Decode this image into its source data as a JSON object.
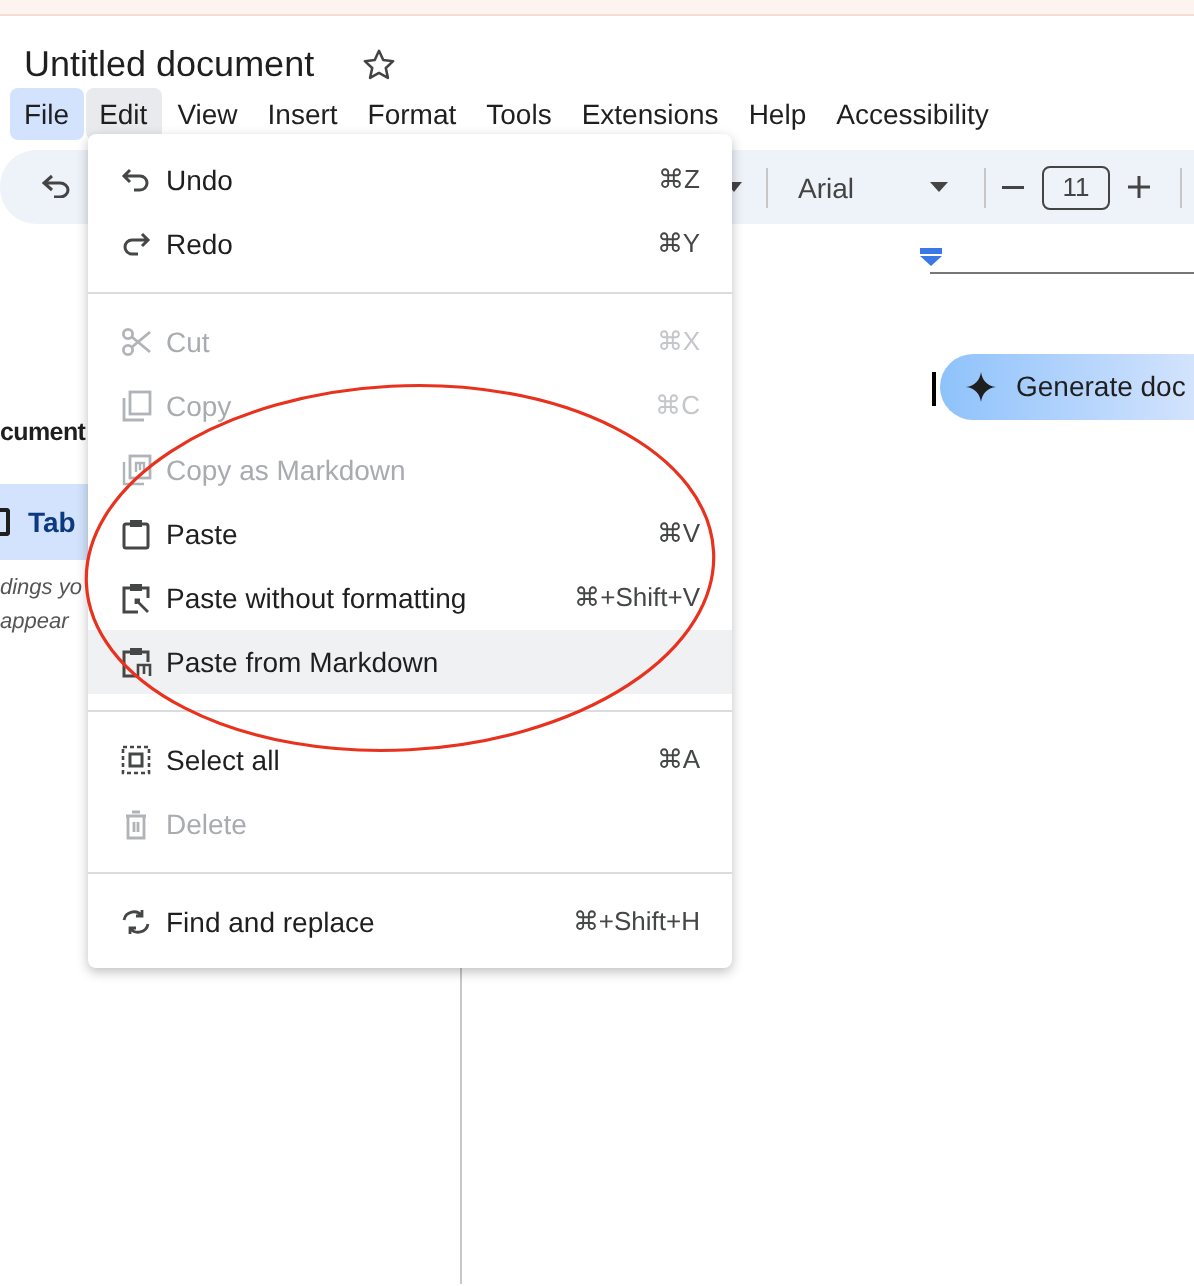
{
  "document": {
    "title": "Untitled document",
    "starred": false
  },
  "menubar": [
    {
      "label": "File",
      "selected": false,
      "highlighted": true
    },
    {
      "label": "Edit",
      "selected": true,
      "highlighted": false
    },
    {
      "label": "View",
      "selected": false,
      "highlighted": false
    },
    {
      "label": "Insert",
      "selected": false,
      "highlighted": false
    },
    {
      "label": "Format",
      "selected": false,
      "highlighted": false
    },
    {
      "label": "Tools",
      "selected": false,
      "highlighted": false
    },
    {
      "label": "Extensions",
      "selected": false,
      "highlighted": false
    },
    {
      "label": "Help",
      "selected": false,
      "highlighted": false
    },
    {
      "label": "Accessibility",
      "selected": false,
      "highlighted": false
    }
  ],
  "toolbar": {
    "font": "Arial",
    "font_size": "11"
  },
  "side_panel": {
    "heading": "cument",
    "tab": {
      "label": "Tab",
      "selected": true
    },
    "hint_lines": [
      "dings yo",
      "appear"
    ]
  },
  "generate_button": {
    "label": "Generate doc"
  },
  "edit_menu": [
    {
      "kind": "item",
      "label": "Undo",
      "shortcut": "⌘Z",
      "disabled": false,
      "selected": false
    },
    {
      "kind": "item",
      "label": "Redo",
      "shortcut": "⌘Y",
      "disabled": false,
      "selected": false
    },
    {
      "kind": "divider"
    },
    {
      "kind": "item",
      "label": "Cut",
      "shortcut": "⌘X",
      "disabled": true,
      "selected": false
    },
    {
      "kind": "item",
      "label": "Copy",
      "shortcut": "⌘C",
      "disabled": true,
      "selected": false
    },
    {
      "kind": "item",
      "label": "Copy as Markdown",
      "disabled": true,
      "selected": false
    },
    {
      "kind": "item",
      "label": "Paste",
      "shortcut": "⌘V",
      "disabled": false,
      "selected": false
    },
    {
      "kind": "item",
      "label": "Paste without formatting",
      "shortcut": "⌘+Shift+V",
      "disabled": false,
      "selected": false
    },
    {
      "kind": "item",
      "label": "Paste from Markdown",
      "disabled": false,
      "selected": true
    },
    {
      "kind": "divider"
    },
    {
      "kind": "item",
      "label": "Select all",
      "shortcut": "⌘A",
      "disabled": false,
      "selected": false
    },
    {
      "kind": "item",
      "label": "Delete",
      "disabled": true,
      "selected": false
    },
    {
      "kind": "divider"
    },
    {
      "kind": "item",
      "label": "Find and replace",
      "shortcut": "⌘+Shift+H",
      "disabled": false,
      "selected": false
    }
  ],
  "annotation": {
    "kind": "ellipse"
  }
}
